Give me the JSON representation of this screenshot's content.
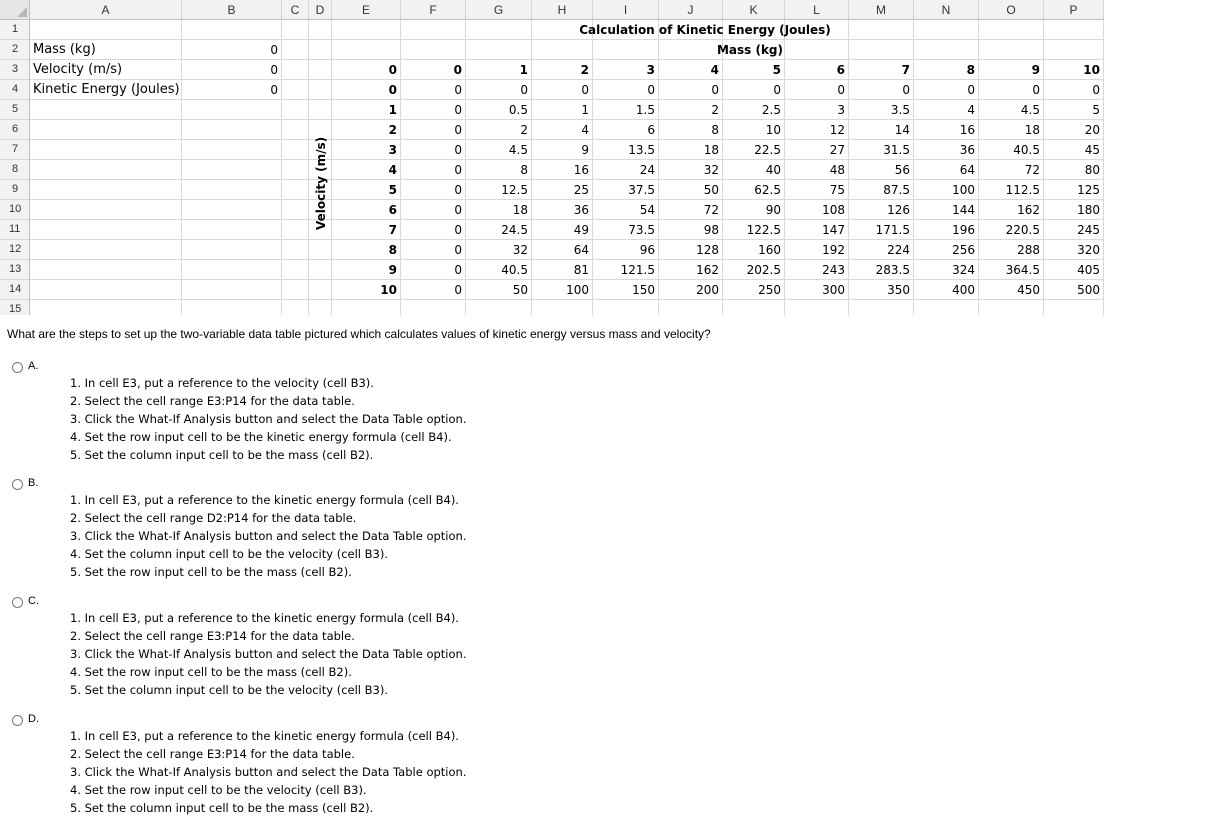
{
  "sheet": {
    "columns": [
      "A",
      "B",
      "C",
      "D",
      "E",
      "F",
      "G",
      "H",
      "I",
      "J",
      "K",
      "L",
      "M",
      "N",
      "O",
      "P"
    ],
    "rows": [
      "1",
      "2",
      "3",
      "4",
      "5",
      "6",
      "7",
      "8",
      "9",
      "10",
      "11",
      "12",
      "13",
      "14",
      "15"
    ],
    "labels": {
      "mass": "Mass (kg)",
      "velocity": "Velocity (m/s)",
      "kinetic": "Kinetic Energy (Joules)"
    },
    "inputs": {
      "mass": "0",
      "velocity": "0",
      "kinetic": "0"
    },
    "title": "Calculation of Kinetic Energy (Joules)",
    "mass_axis_label": "Mass (kg)",
    "velocity_axis_label": "Velocity (m/s)",
    "header_row": [
      "0",
      "0",
      "1",
      "2",
      "3",
      "4",
      "5",
      "6",
      "7",
      "8",
      "9",
      "10"
    ],
    "table": [
      [
        "0",
        "0",
        "0",
        "0",
        "0",
        "0",
        "0",
        "0",
        "0",
        "0",
        "0",
        "0"
      ],
      [
        "1",
        "0",
        "0.5",
        "1",
        "1.5",
        "2",
        "2.5",
        "3",
        "3.5",
        "4",
        "4.5",
        "5"
      ],
      [
        "2",
        "0",
        "2",
        "4",
        "6",
        "8",
        "10",
        "12",
        "14",
        "16",
        "18",
        "20"
      ],
      [
        "3",
        "0",
        "4.5",
        "9",
        "13.5",
        "18",
        "22.5",
        "27",
        "31.5",
        "36",
        "40.5",
        "45"
      ],
      [
        "4",
        "0",
        "8",
        "16",
        "24",
        "32",
        "40",
        "48",
        "56",
        "64",
        "72",
        "80"
      ],
      [
        "5",
        "0",
        "12.5",
        "25",
        "37.5",
        "50",
        "62.5",
        "75",
        "87.5",
        "100",
        "112.5",
        "125"
      ],
      [
        "6",
        "0",
        "18",
        "36",
        "54",
        "72",
        "90",
        "108",
        "126",
        "144",
        "162",
        "180"
      ],
      [
        "7",
        "0",
        "24.5",
        "49",
        "73.5",
        "98",
        "122.5",
        "147",
        "171.5",
        "196",
        "220.5",
        "245"
      ],
      [
        "8",
        "0",
        "32",
        "64",
        "96",
        "128",
        "160",
        "192",
        "224",
        "256",
        "288",
        "320"
      ],
      [
        "9",
        "0",
        "40.5",
        "81",
        "121.5",
        "162",
        "202.5",
        "243",
        "283.5",
        "324",
        "364.5",
        "405"
      ],
      [
        "10",
        "0",
        "50",
        "100",
        "150",
        "200",
        "250",
        "300",
        "350",
        "400",
        "450",
        "500"
      ]
    ]
  },
  "question": {
    "text": "What are the steps to set up the two-variable data table pictured which calculates values of kinetic energy versus mass and velocity?",
    "options": [
      {
        "letter": "A.",
        "steps": [
          "1. In cell E3, put a reference to the velocity (cell B3).",
          "2. Select the cell range E3:P14 for the data table.",
          "3. Click the What-If Analysis button and select the Data Table option.",
          "4. Set the row input cell to be the kinetic energy formula (cell B4).",
          "5. Set the column input cell to be the mass (cell B2)."
        ]
      },
      {
        "letter": "B.",
        "steps": [
          "1. In cell E3, put a reference to the kinetic energy formula (cell B4).",
          "2. Select the cell range D2:P14 for the data table.",
          "3. Click the What-If Analysis button and select the Data Table option.",
          "4. Set the column input cell to be the velocity (cell B3).",
          "5. Set the row input cell to be the mass (cell B2)."
        ]
      },
      {
        "letter": "C.",
        "steps": [
          "1. In cell E3, put a reference to the kinetic energy formula (cell B4).",
          "2. Select the cell range E3:P14 for the data table.",
          "3. Click the What-If Analysis button and select the Data Table option.",
          "4. Set the row input cell to be the mass (cell B2).",
          "5. Set the column input cell to be the velocity (cell B3)."
        ]
      },
      {
        "letter": "D.",
        "steps": [
          "1. In cell E3, put a reference to the kinetic energy formula (cell B4).",
          "2. Select the cell range E3:P14 for the data table.",
          "3. Click the What-If Analysis button and select the Data Table option.",
          "4. Set the row input cell to be the velocity (cell B3).",
          "5. Set the column input cell to be the mass (cell B2)."
        ]
      }
    ]
  }
}
